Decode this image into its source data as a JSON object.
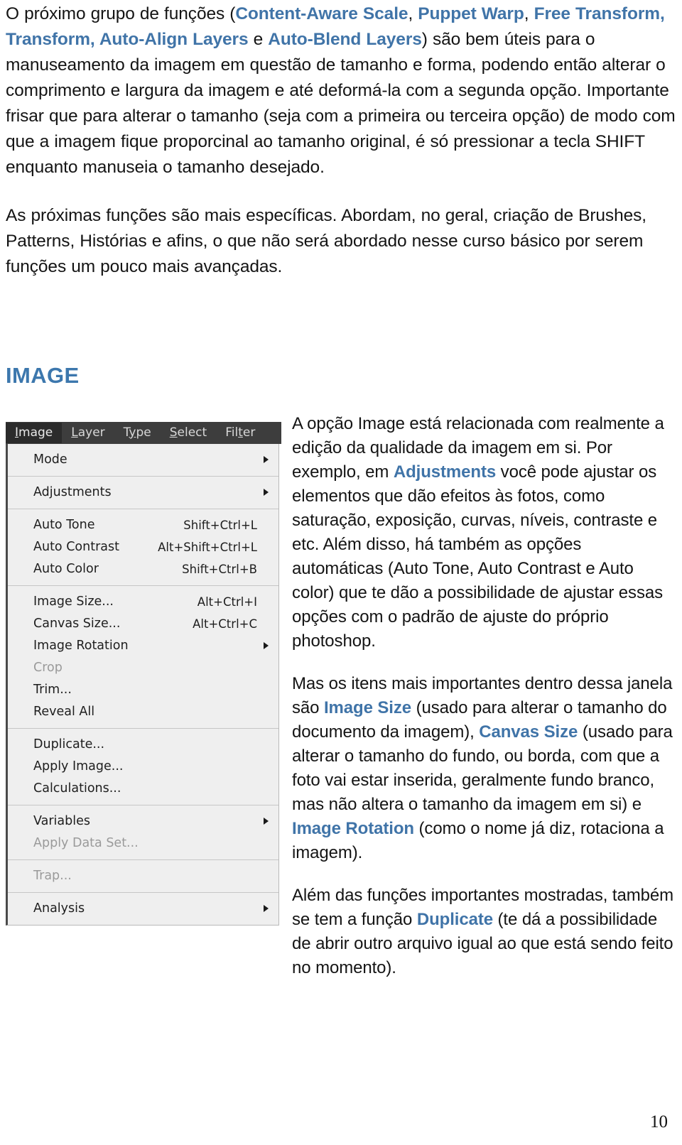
{
  "document": {
    "page_number": "10",
    "accent_color": "#4074a8",
    "heading_color": "#3c77ad"
  },
  "intro": {
    "p1": {
      "seg1": "O próximo grupo de funções (",
      "link1": "Content-Aware Scale",
      "seg2": ", ",
      "link2": "Puppet Warp",
      "seg3": ", ",
      "link3": "Free Transform, Transform, Auto-Align Layers",
      "seg4": " e ",
      "link4": "Auto-Blend Layers",
      "seg5": ") são bem úteis para o manuseamento da imagem em questão de tamanho e forma, podendo então alterar o comprimento e largura da imagem e até deformá-la com a segunda opção. Importante frisar que para alterar o tamanho (seja com a primeira ou terceira opção) de modo com que a imagem fique proporcinal ao tamanho original, é só pressionar a tecla SHIFT enquanto manuseia o tamanho desejado."
    },
    "p2": "As próximas funções são mais específicas. Abordam, no geral, criação de Brushes, Patterns, Histórias e afins, o que não será abordado nesse curso básico por serem funções um pouco mais avançadas."
  },
  "section": {
    "heading": "IMAGE"
  },
  "ps_menu": {
    "menubar": [
      {
        "label": "Image",
        "mnemonic": "I",
        "active": true
      },
      {
        "label": "Layer",
        "mnemonic": "L",
        "active": false
      },
      {
        "label": "Type",
        "mnemonic": "y",
        "active": false
      },
      {
        "label": "Select",
        "mnemonic": "S",
        "active": false
      },
      {
        "label": "Filter",
        "mnemonic": "t",
        "active": false
      }
    ],
    "groups": [
      {
        "items": [
          {
            "label": "Mode",
            "shortcut": "",
            "submenu": true,
            "disabled": false
          }
        ]
      },
      {
        "items": [
          {
            "label": "Adjustments",
            "shortcut": "",
            "submenu": true,
            "disabled": false
          }
        ]
      },
      {
        "items": [
          {
            "label": "Auto Tone",
            "shortcut": "Shift+Ctrl+L",
            "submenu": false,
            "disabled": false
          },
          {
            "label": "Auto Contrast",
            "shortcut": "Alt+Shift+Ctrl+L",
            "submenu": false,
            "disabled": false
          },
          {
            "label": "Auto Color",
            "shortcut": "Shift+Ctrl+B",
            "submenu": false,
            "disabled": false
          }
        ]
      },
      {
        "items": [
          {
            "label": "Image Size...",
            "shortcut": "Alt+Ctrl+I",
            "submenu": false,
            "disabled": false
          },
          {
            "label": "Canvas Size...",
            "shortcut": "Alt+Ctrl+C",
            "submenu": false,
            "disabled": false
          },
          {
            "label": "Image Rotation",
            "shortcut": "",
            "submenu": true,
            "disabled": false
          },
          {
            "label": "Crop",
            "shortcut": "",
            "submenu": false,
            "disabled": true
          },
          {
            "label": "Trim...",
            "shortcut": "",
            "submenu": false,
            "disabled": false
          },
          {
            "label": "Reveal All",
            "shortcut": "",
            "submenu": false,
            "disabled": false
          }
        ]
      },
      {
        "items": [
          {
            "label": "Duplicate...",
            "shortcut": "",
            "submenu": false,
            "disabled": false
          },
          {
            "label": "Apply Image...",
            "shortcut": "",
            "submenu": false,
            "disabled": false
          },
          {
            "label": "Calculations...",
            "shortcut": "",
            "submenu": false,
            "disabled": false
          }
        ]
      },
      {
        "items": [
          {
            "label": "Variables",
            "shortcut": "",
            "submenu": true,
            "disabled": false
          },
          {
            "label": "Apply Data Set...",
            "shortcut": "",
            "submenu": false,
            "disabled": true
          }
        ]
      },
      {
        "items": [
          {
            "label": "Trap...",
            "shortcut": "",
            "submenu": false,
            "disabled": true
          }
        ]
      },
      {
        "items": [
          {
            "label": "Analysis",
            "shortcut": "",
            "submenu": true,
            "disabled": false
          }
        ]
      }
    ]
  },
  "body": {
    "p1": {
      "seg1": "A opção Image está relacionada com realmente a edição da qualidade da imagem em si. Por exemplo, em ",
      "link1": "Adjustments",
      "seg2": " você pode ajustar os elementos que dão efeitos às fotos, como saturação, exposição, curvas, níveis, contraste e etc. Além disso, há também as opções automáticas (Auto Tone, Auto Contrast e Auto color) que te dão a possibilidade de ajustar essas opções com o padrão de ajuste do próprio photoshop."
    },
    "p2": {
      "seg1": "Mas os itens mais importantes dentro dessa janela são ",
      "link1": "Image Size",
      "seg2": " (usado para alterar o tamanho do documento da imagem), ",
      "link2": "Canvas Size",
      "seg3": " (usado para alterar o tamanho do fundo, ou borda, com que a foto vai estar inserida, geralmente fundo branco, mas não altera o tamanho da imagem em si) e ",
      "link3": "Image Rotation",
      "seg4": " (como o nome já diz, rotaciona a imagem)."
    },
    "p3": {
      "seg1": "Além das funções importantes mostradas, também se tem a função ",
      "link1": "Duplicate",
      "seg2": " (te dá a possibilidade de abrir outro arquivo igual ao que está sendo feito no momento)."
    }
  }
}
